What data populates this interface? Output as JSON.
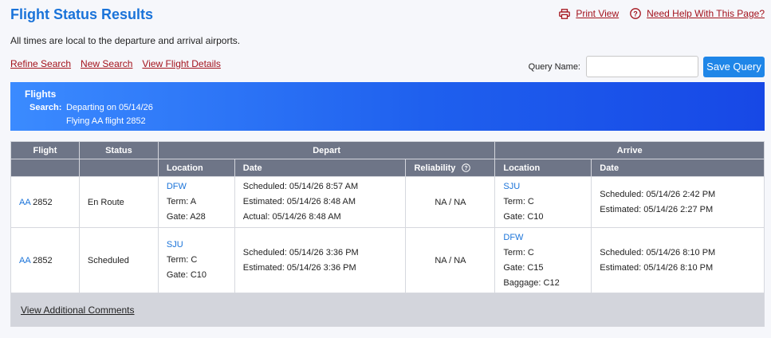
{
  "page": {
    "title": "Flight Status Results",
    "subtitle": "All times are local to the departure and arrival airports."
  },
  "top_links": {
    "print": "Print View",
    "help": "Need Help With This Page?"
  },
  "nav_links": {
    "refine": "Refine Search",
    "new": "New Search",
    "details": "View Flight Details"
  },
  "query": {
    "label": "Query Name:",
    "value": "",
    "save_label": "Save Query"
  },
  "banner": {
    "title": "Flights",
    "search_label": "Search:",
    "line1": "Departing on 05/14/26",
    "line2": "Flying AA flight 2852"
  },
  "table": {
    "headers": {
      "flight": "Flight",
      "status": "Status",
      "depart": "Depart",
      "arrive": "Arrive",
      "location": "Location",
      "date": "Date",
      "reliability": "Reliability"
    },
    "rows": [
      {
        "airline": "AA",
        "number": "2852",
        "status": "En Route",
        "dep_airport": "DFW",
        "dep_term": "Term: A",
        "dep_gate": "Gate: A28",
        "dep_scheduled": "Scheduled: 05/14/26 8:57 AM",
        "dep_estimated": "Estimated:  05/14/26 8:48 AM",
        "dep_actual": "Actual:  05/14/26 8:48 AM",
        "reliability": "NA / NA",
        "arr_airport": "SJU",
        "arr_term": "Term: C",
        "arr_gate": "Gate: C10",
        "arr_scheduled": "Scheduled: 05/14/26 2:42 PM",
        "arr_estimated": "Estimated:  05/14/26 2:27 PM"
      },
      {
        "airline": "AA",
        "number": "2852",
        "status": "Scheduled",
        "dep_airport": "SJU",
        "dep_term": "Term: C",
        "dep_gate": "Gate: C10",
        "dep_scheduled": "Scheduled: 05/14/26 3:36 PM",
        "dep_estimated": "Estimated:  05/14/26 3:36 PM",
        "reliability": "NA / NA",
        "arr_airport": "DFW",
        "arr_term": "Term: C",
        "arr_gate": "Gate: C15",
        "arr_baggage": "Baggage: C12",
        "arr_scheduled": "Scheduled: 05/14/26 8:10 PM",
        "arr_estimated": "Estimated:  05/14/26 8:10 PM"
      }
    ],
    "footer_link": "View Additional Comments"
  },
  "colors": {
    "title_blue": "#1a73d9",
    "link_red": "#a3121b",
    "header_gray": "#6e7587",
    "banner_start": "#3b8bff",
    "banner_end": "#1748e6"
  }
}
